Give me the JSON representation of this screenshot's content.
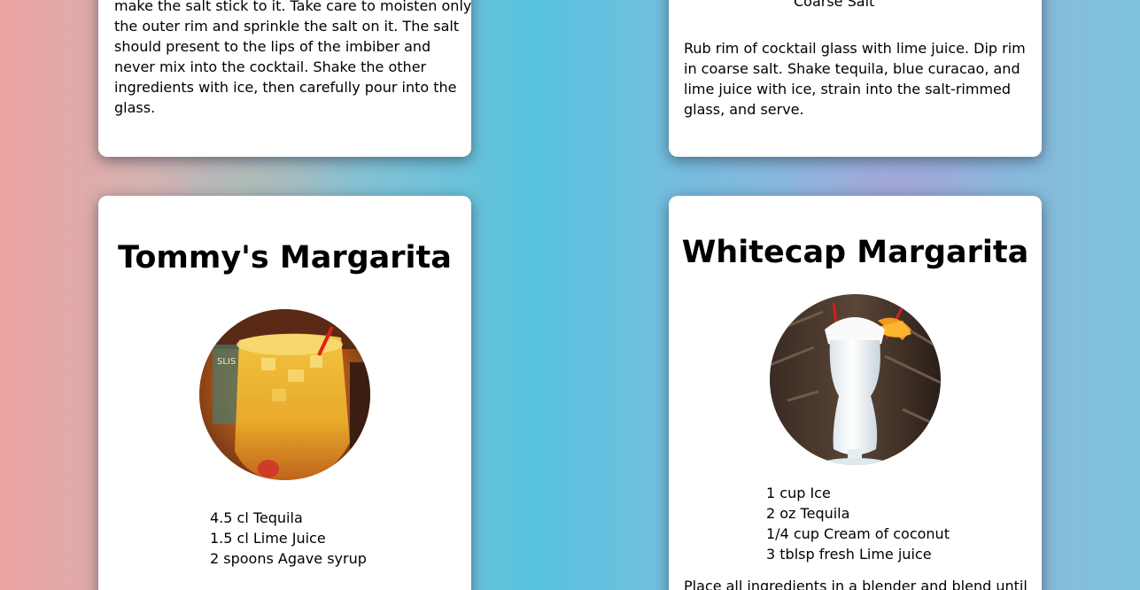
{
  "cards": [
    {
      "method_lines": [
        "make the salt stick to it. Take care to moisten only",
        "the outer rim and sprinkle the salt on it. The salt",
        "should present to the lips of the imbiber and",
        "never mix into the cocktail. Shake the other",
        "ingredients with ice, then carefully pour into the",
        "glass."
      ]
    },
    {
      "last_ingredient": "Coarse Salt",
      "method_lines": [
        "Rub rim of cocktail glass with lime juice. Dip rim",
        "in coarse salt. Shake tequila, blue curacao, and",
        "lime juice with ice, strain into the salt-rimmed",
        "glass, and serve."
      ]
    },
    {
      "title": "Tommy's Margarita",
      "photo_icon": "margarita-glass-photo",
      "ingredients": [
        "4.5 cl Tequila",
        "1.5 cl Lime Juice",
        "2 spoons Agave syrup"
      ]
    },
    {
      "title": "Whitecap Margarita",
      "photo_icon": "whitecap-glass-photo",
      "ingredients": [
        "1 cup Ice",
        "2 oz Tequila",
        "1/4 cup Cream of coconut",
        "3 tblsp fresh Lime juice"
      ],
      "method_partial": "Place all ingredients in a blender and blend until"
    }
  ]
}
